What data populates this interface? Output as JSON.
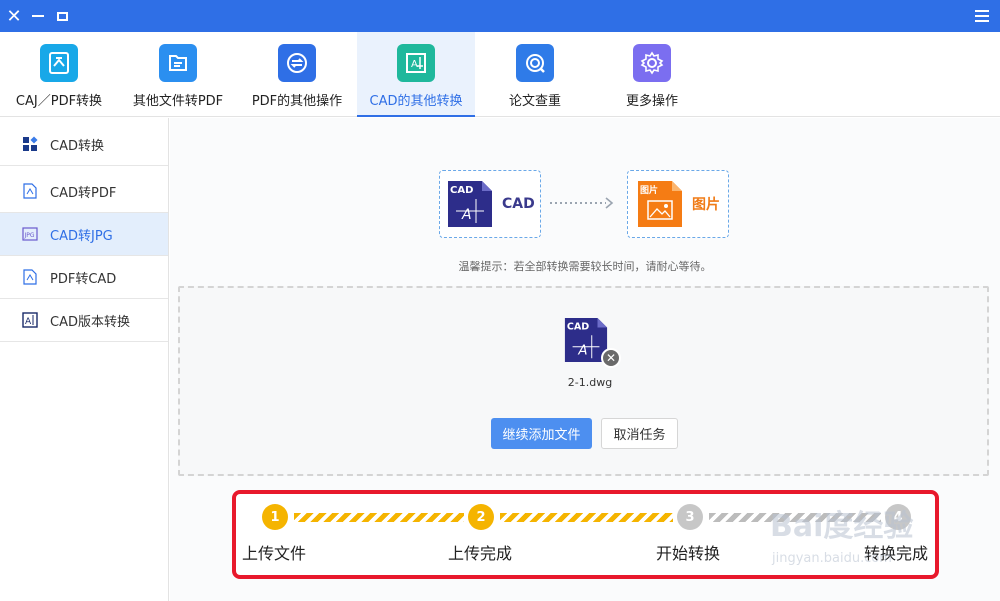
{
  "window": {
    "close_glyph": "✕"
  },
  "nav": {
    "tabs": [
      {
        "label": "CAJ／PDF转换",
        "icon": "caj-pdf-convert-icon",
        "color": "#18a8e8"
      },
      {
        "label": "其他文件转PDF",
        "icon": "file-to-pdf-icon",
        "color": "#2b8ff0"
      },
      {
        "label": "PDF的其他操作",
        "icon": "pdf-swap-icon",
        "color": "#2f6fe6"
      },
      {
        "label": "CAD的其他转换",
        "icon": "cad-frame-icon",
        "color": "#1fb89c",
        "active": true
      },
      {
        "label": "论文查重",
        "icon": "thesis-check-icon",
        "color": "#2f7be8"
      },
      {
        "label": "更多操作",
        "icon": "gear-icon",
        "color": "#7b6ef0"
      }
    ]
  },
  "sidebar": {
    "items": [
      {
        "label": "CAD转换",
        "icon": "grid-apps-icon"
      },
      {
        "label": "CAD转PDF",
        "icon": "pdf-file-icon"
      },
      {
        "label": "CAD转JPG",
        "icon": "jpg-file-icon",
        "active": true
      },
      {
        "label": "PDF转CAD",
        "icon": "pdf-file-icon"
      },
      {
        "label": "CAD版本转换",
        "icon": "cad-version-icon"
      }
    ]
  },
  "conversion": {
    "from_label": "CAD",
    "from_badge": "CAD",
    "to_label": "图片",
    "to_badge": "图片",
    "hint": "温馨提示：若全部转换需要较长时间，请耐心等待。"
  },
  "file": {
    "badge": "CAD",
    "name": "2-1.dwg",
    "remove_glyph": "✕"
  },
  "buttons": {
    "add_more": "继续添加文件",
    "cancel": "取消任务"
  },
  "progress": {
    "steps": [
      {
        "num": "1",
        "label": "上传文件",
        "done": true
      },
      {
        "num": "2",
        "label": "上传完成",
        "done": true
      },
      {
        "num": "3",
        "label": "开始转换",
        "done": false
      },
      {
        "num": "4",
        "label": "转换完成",
        "done": false
      }
    ]
  },
  "watermark": {
    "text": "Bai度经验",
    "sub": "jingyan.baidu.com"
  }
}
